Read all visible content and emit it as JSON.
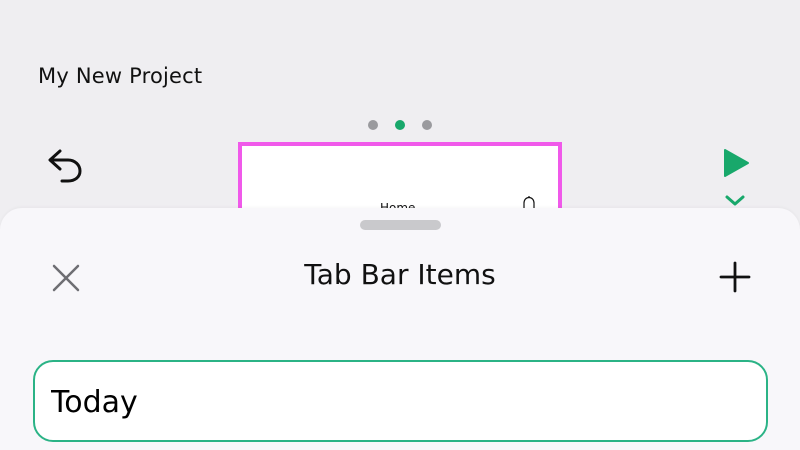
{
  "header": {
    "project_title": "My New Project",
    "undo_icon": "undo-icon",
    "play_icon": "play-icon",
    "expand_icon": "chevron-down-icon",
    "accent_color": "#18a86b"
  },
  "pager": {
    "count": 3,
    "active_index": 1
  },
  "preview": {
    "title": "Home",
    "bell_icon": "bell-icon",
    "frame_color": "#f059ea"
  },
  "sheet": {
    "title": "Tab Bar Items",
    "close_icon": "close-icon",
    "add_icon": "plus-icon",
    "items": [
      {
        "value": "Today"
      }
    ]
  }
}
